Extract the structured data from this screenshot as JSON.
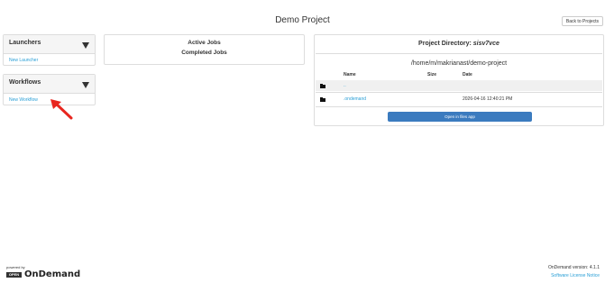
{
  "page": {
    "title": "Demo Project",
    "back_button": "Back to Projects"
  },
  "launchers": {
    "title": "Launchers",
    "link": "New Launcher"
  },
  "workflows": {
    "title": "Workflows",
    "link": "New Workflow"
  },
  "jobs": {
    "active": "Active Jobs",
    "completed": "Completed Jobs"
  },
  "project_dir": {
    "label": "Project Directory:",
    "name": "sisv7vce",
    "path": "/home/m/makrianast/demo-project",
    "headers": {
      "name": "Name",
      "size": "Size",
      "date": "Date"
    },
    "rows": [
      {
        "name": "..",
        "size": "",
        "date": ""
      },
      {
        "name": ".ondemand",
        "size": "",
        "date": "2026-04-16 12:40:21 PM"
      }
    ],
    "open_button": "Open in files app"
  },
  "footer": {
    "powered_by": "powered by",
    "logo_open": "OPEN",
    "logo_text": "OnDemand",
    "version": "OnDemand version: 4.1.1",
    "license": "Software License Notice"
  },
  "colors": {
    "link": "#2a9fd6",
    "button": "#3b7bbf",
    "arrow": "#e8261f"
  }
}
